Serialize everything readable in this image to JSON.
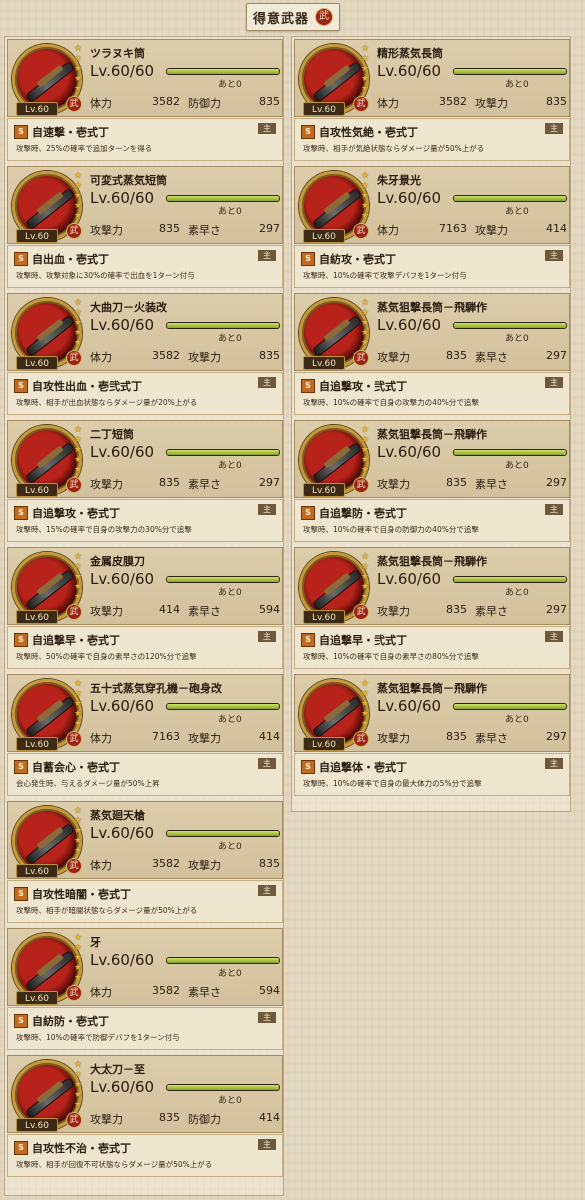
{
  "header": {
    "title": "得意武器",
    "emblem": "武"
  },
  "level_badge": "Lv.60",
  "remaining_label": "あと0",
  "type_badge": "武",
  "main_tag": "主",
  "skill_icon": "S",
  "left": [
    {
      "name": "ツラヌキ筒",
      "level": "Lv.60/60",
      "exp_fill": 1.0,
      "stats": [
        {
          "label": "体力",
          "value": "3582"
        },
        {
          "label": "防御力",
          "value": "835"
        }
      ],
      "skill": "自速撃・壱式丁",
      "desc": "攻撃時、25%の確率で追加ターンを得る"
    },
    {
      "name": "可変式蒸気短筒",
      "level": "Lv.60/60",
      "exp_fill": 1.0,
      "stats": [
        {
          "label": "攻撃力",
          "value": "835"
        },
        {
          "label": "素早さ",
          "value": "297"
        }
      ],
      "skill": "自出血・壱式丁",
      "desc": "攻撃時、攻撃対象に30%の確率で出血を1ターン付与"
    },
    {
      "name": "大曲刀－火装改",
      "level": "Lv.60/60",
      "exp_fill": 1.0,
      "stats": [
        {
          "label": "体力",
          "value": "3582"
        },
        {
          "label": "攻撃力",
          "value": "835"
        }
      ],
      "skill": "自攻性出血・壱弐式丁",
      "desc": "攻撃時、相手が出血状態ならダメージ量が20%上がる"
    },
    {
      "name": "二丁短筒",
      "level": "Lv.60/60",
      "exp_fill": 1.0,
      "stats": [
        {
          "label": "攻撃力",
          "value": "835"
        },
        {
          "label": "素早さ",
          "value": "297"
        }
      ],
      "skill": "自追撃攻・壱式丁",
      "desc": "攻撃時、15%の確率で自身の攻撃力の30%分で追撃"
    },
    {
      "name": "金属皮膜刀",
      "level": "Lv.60/60",
      "exp_fill": 1.0,
      "stats": [
        {
          "label": "攻撃力",
          "value": "414"
        },
        {
          "label": "素早さ",
          "value": "594"
        }
      ],
      "skill": "自追撃早・壱式丁",
      "desc": "攻撃時、50%の確率で自身の素早さの120%分で追撃"
    },
    {
      "name": "五十式蒸気穿孔機－砲身改",
      "level": "Lv.60/60",
      "exp_fill": 1.0,
      "stats": [
        {
          "label": "体力",
          "value": "7163"
        },
        {
          "label": "攻撃力",
          "value": "414"
        }
      ],
      "skill": "自蓄会心・壱式丁",
      "desc": "会心発生時、与えるダメージ量が50%上昇"
    },
    {
      "name": "蒸気廻天槍",
      "level": "Lv.60/60",
      "exp_fill": 1.0,
      "stats": [
        {
          "label": "体力",
          "value": "3582"
        },
        {
          "label": "攻撃力",
          "value": "835"
        }
      ],
      "skill": "自攻性暗闇・壱式丁",
      "desc": "攻撃時、相手が暗闇状態ならダメージ量が50%上がる"
    },
    {
      "name": "牙",
      "level": "Lv.60/60",
      "exp_fill": 1.0,
      "stats": [
        {
          "label": "体力",
          "value": "3582"
        },
        {
          "label": "素早さ",
          "value": "594"
        }
      ],
      "skill": "自紡防・壱式丁",
      "desc": "攻撃時、10%の確率で防御デバフを1ターン付与"
    },
    {
      "name": "大太刀－至",
      "level": "Lv.60/60",
      "exp_fill": 1.0,
      "stats": [
        {
          "label": "攻撃力",
          "value": "835"
        },
        {
          "label": "防御力",
          "value": "414"
        }
      ],
      "skill": "自攻性不治・壱式丁",
      "desc": "攻撃時、相手が回復不可状態ならダメージ量が50%上がる"
    }
  ],
  "right": [
    {
      "name": "精形蒸気長筒",
      "level": "Lv.60/60",
      "exp_fill": 1.0,
      "stats": [
        {
          "label": "体力",
          "value": "3582"
        },
        {
          "label": "攻撃力",
          "value": "835"
        }
      ],
      "skill": "自攻性気絶・壱式丁",
      "desc": "攻撃時、相手が気絶状態ならダメージ量が50%上がる"
    },
    {
      "name": "朱牙景光",
      "level": "Lv.60/60",
      "exp_fill": 1.0,
      "stats": [
        {
          "label": "体力",
          "value": "7163"
        },
        {
          "label": "攻撃力",
          "value": "414"
        }
      ],
      "skill": "自紡攻・壱式丁",
      "desc": "攻撃時、10%の確率で攻撃デバフを1ターン付与"
    },
    {
      "name": "蒸気狙撃長筒－飛騨作",
      "level": "Lv.60/60",
      "exp_fill": 1.0,
      "stats": [
        {
          "label": "攻撃力",
          "value": "835"
        },
        {
          "label": "素早さ",
          "value": "297"
        }
      ],
      "skill": "自追撃攻・弐式丁",
      "desc": "攻撃時、10%の確率で自身の攻撃力の40%分で追撃"
    },
    {
      "name": "蒸気狙撃長筒－飛騨作",
      "level": "Lv.60/60",
      "exp_fill": 1.0,
      "stats": [
        {
          "label": "攻撃力",
          "value": "835"
        },
        {
          "label": "素早さ",
          "value": "297"
        }
      ],
      "skill": "自追撃防・壱式丁",
      "desc": "攻撃時、10%の確率で自身の防御力の40%分で追撃"
    },
    {
      "name": "蒸気狙撃長筒－飛騨作",
      "level": "Lv.60/60",
      "exp_fill": 1.0,
      "stats": [
        {
          "label": "攻撃力",
          "value": "835"
        },
        {
          "label": "素早さ",
          "value": "297"
        }
      ],
      "skill": "自追撃早・弐式丁",
      "desc": "攻撃時、10%の確率で自身の素早さの80%分で追撃"
    },
    {
      "name": "蒸気狙撃長筒－飛騨作",
      "level": "Lv.60/60",
      "exp_fill": 1.0,
      "stats": [
        {
          "label": "攻撃力",
          "value": "835"
        },
        {
          "label": "素早さ",
          "value": "297"
        }
      ],
      "skill": "自追撃体・壱式丁",
      "desc": "攻撃時、10%の確率で自身の最大体力の5%分で追撃"
    }
  ]
}
